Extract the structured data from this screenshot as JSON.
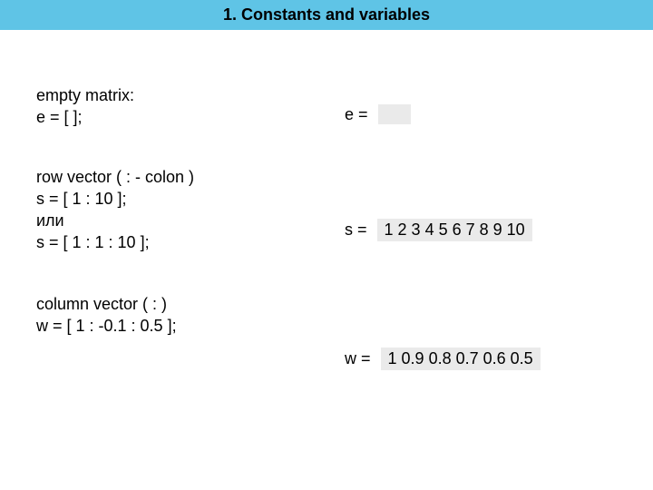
{
  "title": "1. Constants and variables",
  "block1": {
    "heading": "empty matrix:",
    "code1": "e = [ ];",
    "result_label": "e =",
    "result_value": ""
  },
  "block2": {
    "heading": "row vector ( : - colon )",
    "code1": "s = [ 1 : 10 ];",
    "code2": "или",
    "code3": "s = [ 1 : 1 : 10 ];",
    "result_label": "s =",
    "result_value": "1  2  3  4  5  6  7  8  9  10"
  },
  "block3": {
    "heading": "column vector ( : )",
    "code1": "w = [ 1 : -0.1 : 0.5 ];",
    "result_label": "w =",
    "result_value": "1  0.9  0.8  0.7  0.6  0.5"
  }
}
